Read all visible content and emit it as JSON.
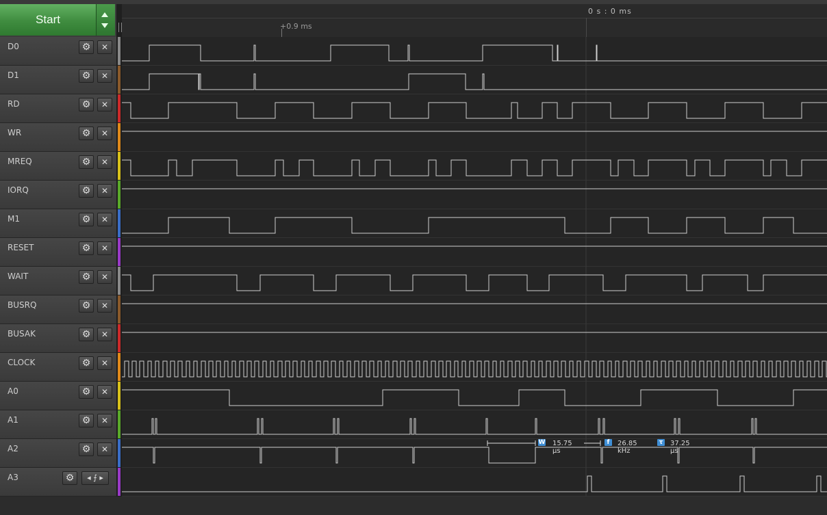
{
  "toolbar": {
    "start_label": "Start"
  },
  "timeline": {
    "absolute_time": "0 s : 0 ms",
    "relative_time": "+0.9 ms"
  },
  "channels": [
    {
      "name": "D0",
      "color": "#8a8a8a"
    },
    {
      "name": "D1",
      "color": "#8b5a2b"
    },
    {
      "name": "RD",
      "color": "#cc2a2a"
    },
    {
      "name": "WR",
      "color": "#e08a1a"
    },
    {
      "name": "MREQ",
      "color": "#d8c21a"
    },
    {
      "name": "IORQ",
      "color": "#5aaa2a"
    },
    {
      "name": "M1",
      "color": "#3a6ec8"
    },
    {
      "name": "RESET",
      "color": "#9a3ac8"
    },
    {
      "name": "WAIT",
      "color": "#8a8a8a"
    },
    {
      "name": "BUSRQ",
      "color": "#8b5a2b"
    },
    {
      "name": "BUSAK",
      "color": "#cc2a2a"
    },
    {
      "name": "CLOCK",
      "color": "#e08a1a"
    },
    {
      "name": "A0",
      "color": "#d8c21a"
    },
    {
      "name": "A1",
      "color": "#5aaa2a"
    },
    {
      "name": "A2",
      "color": "#3a6ec8"
    },
    {
      "name": "A3",
      "color": "#9a3ac8"
    }
  ],
  "measurement": {
    "width_icon": "W",
    "width_value": "15.75 µs",
    "frequency_icon": "f",
    "frequency_value": "26.85 kHz",
    "period_icon": "τ",
    "period_value": "37.25 µs"
  },
  "icons": {
    "settings": "gear-icon",
    "close": "close-icon",
    "trigger": "rising-edge-trigger-icon"
  }
}
